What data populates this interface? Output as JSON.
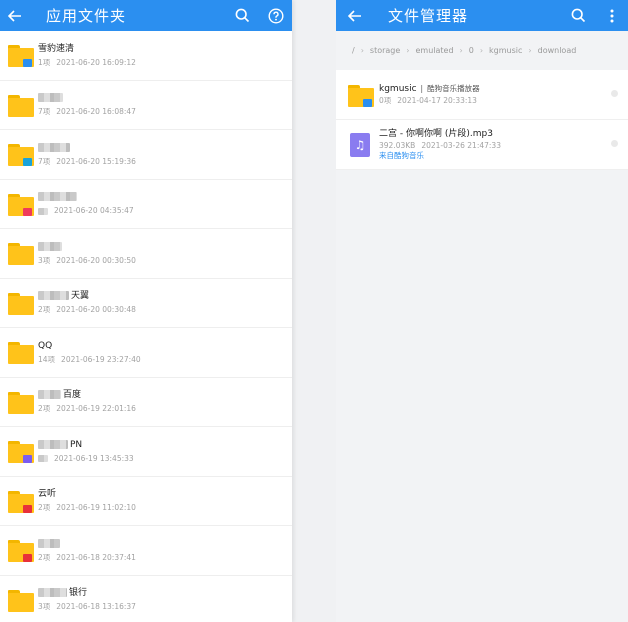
{
  "left": {
    "title": "应用文件夹",
    "items": [
      {
        "name": "雪豹速清",
        "count": "1项",
        "date": "2021-06-20 16:09:12",
        "blurred": false,
        "badge": "#2b8ff0"
      },
      {
        "name": "",
        "count": "7项",
        "date": "2021-06-20 16:08:47",
        "blurred": true,
        "badge": ""
      },
      {
        "name": "",
        "count": "7项",
        "date": "2021-06-20 15:19:36",
        "blurred": true,
        "badge": "#1aa3d9"
      },
      {
        "name": "",
        "count": "",
        "date": "2021-06-20 04:35:47",
        "blurred": true,
        "badge": "#ef3b5a"
      },
      {
        "name": "",
        "count": "3项",
        "date": "2021-06-20 00:30:50",
        "blurred": true,
        "badge": ""
      },
      {
        "name": "天翼",
        "count": "2项",
        "date": "2021-06-20 00:30:48",
        "blurred": true,
        "badge": ""
      },
      {
        "name": "QQ",
        "count": "14项",
        "date": "2021-06-19 23:27:40",
        "blurred": false,
        "badge": ""
      },
      {
        "name": "百度",
        "count": "2项",
        "date": "2021-06-19 22:01:16",
        "blurred": true,
        "badge": ""
      },
      {
        "name": "PN",
        "count": "",
        "date": "2021-06-19 13:45:33",
        "blurred": true,
        "badge": "#7b5cf0"
      },
      {
        "name": "云听",
        "count": "2项",
        "date": "2021-06-19 11:02:10",
        "blurred": false,
        "badge": "#e8313a"
      },
      {
        "name": "",
        "count": "2项",
        "date": "2021-06-18 20:37:41",
        "blurred": true,
        "badge": "#e8313a"
      },
      {
        "name": "银行",
        "count": "3项",
        "date": "2021-06-18 13:16:37",
        "blurred": true,
        "badge": ""
      }
    ]
  },
  "right": {
    "title": "文件管理器",
    "breadcrumb": [
      "/",
      "storage",
      "emulated",
      "0",
      "kgmusic",
      "download"
    ],
    "items": [
      {
        "type": "folder",
        "name": "kgmusic",
        "desc": "酷狗音乐播放器",
        "count": "0项",
        "date": "2021-04-17 20:33:13",
        "source": ""
      },
      {
        "type": "music",
        "name": "二宫 - 你啊你啊 (片段).mp3",
        "desc": "",
        "count": "392.03KB",
        "date": "2021-03-26 21:47:33",
        "source": "来自酷狗音乐"
      }
    ]
  },
  "colors": {
    "accent": "#2b8ff0",
    "folder": "#ffc31a",
    "music": "#8a7cf0"
  }
}
